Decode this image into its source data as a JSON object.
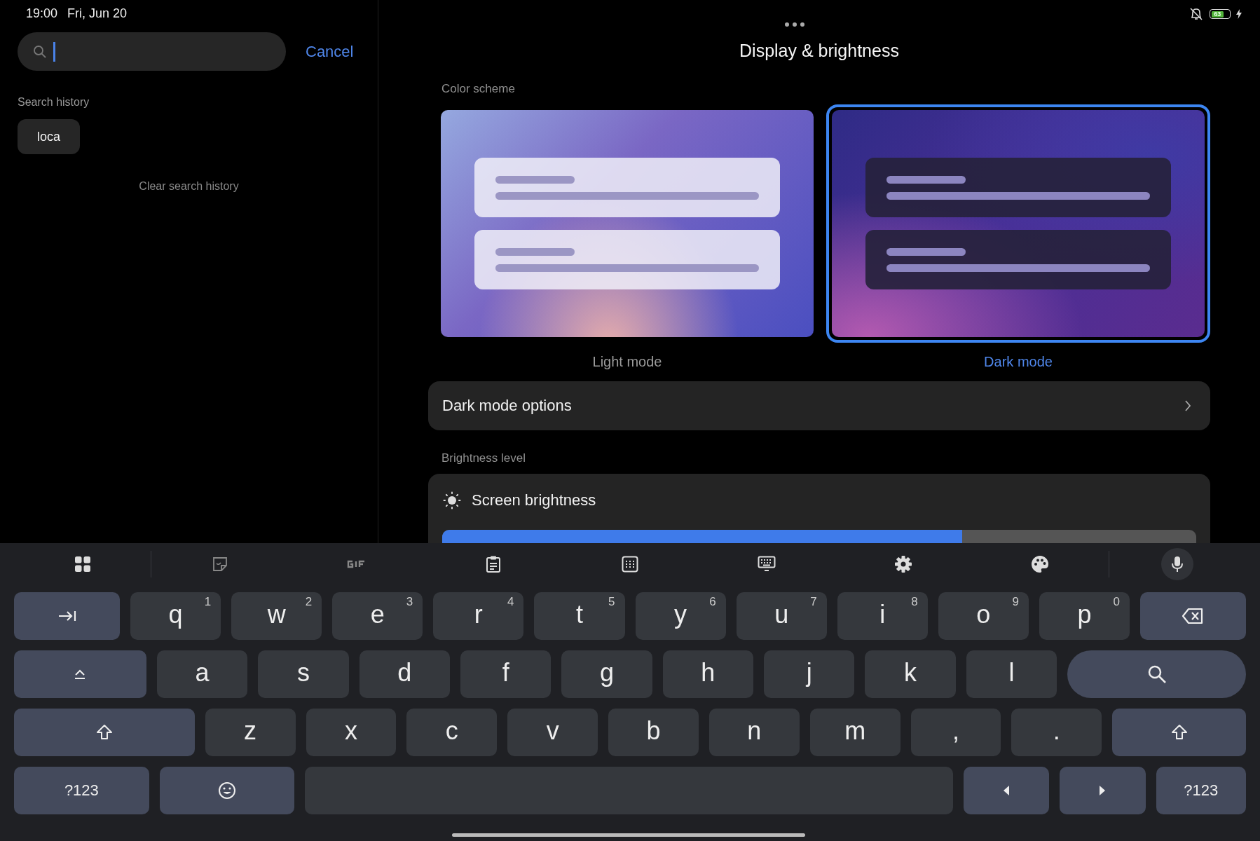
{
  "status_bar": {
    "time": "19:00",
    "date": "Fri, Jun 20",
    "battery": "63"
  },
  "search": {
    "cancel": "Cancel",
    "history_label": "Search history",
    "history": [
      "loca"
    ],
    "clear": "Clear search history"
  },
  "settings": {
    "title": "Display & brightness",
    "color_scheme_label": "Color scheme",
    "schemes": [
      {
        "kind": "light",
        "label": "Light mode",
        "selected": false
      },
      {
        "kind": "dark",
        "label": "Dark mode",
        "selected": true
      }
    ],
    "dark_mode_options": "Dark mode options",
    "brightness_label": "Brightness level",
    "brightness": {
      "label": "Screen brightness",
      "level": 0.69
    }
  },
  "keyboard": {
    "toolbar": [
      {
        "kind": "apps"
      },
      {
        "kind": "sticker"
      },
      {
        "kind": "gif"
      },
      {
        "kind": "clipboard"
      },
      {
        "kind": "numpad"
      },
      {
        "kind": "keyboard"
      },
      {
        "kind": "settings"
      },
      {
        "kind": "palette"
      },
      {
        "kind": "mic"
      }
    ],
    "rows": [
      [
        {
          "kind": "tab"
        },
        {
          "kind": "letter",
          "label": "q",
          "hint": "1"
        },
        {
          "kind": "letter",
          "label": "w",
          "hint": "2"
        },
        {
          "kind": "letter",
          "label": "e",
          "hint": "3"
        },
        {
          "kind": "letter",
          "label": "r",
          "hint": "4"
        },
        {
          "kind": "letter",
          "label": "t",
          "hint": "5"
        },
        {
          "kind": "letter",
          "label": "y",
          "hint": "6"
        },
        {
          "kind": "letter",
          "label": "u",
          "hint": "7"
        },
        {
          "kind": "letter",
          "label": "i",
          "hint": "8"
        },
        {
          "kind": "letter",
          "label": "o",
          "hint": "9"
        },
        {
          "kind": "letter",
          "label": "p",
          "hint": "0"
        },
        {
          "kind": "backspace"
        }
      ],
      [
        {
          "kind": "capslock"
        },
        {
          "kind": "letter",
          "label": "a"
        },
        {
          "kind": "letter",
          "label": "s"
        },
        {
          "kind": "letter",
          "label": "d"
        },
        {
          "kind": "letter",
          "label": "f"
        },
        {
          "kind": "letter",
          "label": "g"
        },
        {
          "kind": "letter",
          "label": "h"
        },
        {
          "kind": "letter",
          "label": "j"
        },
        {
          "kind": "letter",
          "label": "k"
        },
        {
          "kind": "letter",
          "label": "l"
        },
        {
          "kind": "search"
        }
      ],
      [
        {
          "kind": "shift"
        },
        {
          "kind": "letter",
          "label": "z"
        },
        {
          "kind": "letter",
          "label": "x"
        },
        {
          "kind": "letter",
          "label": "c"
        },
        {
          "kind": "letter",
          "label": "v"
        },
        {
          "kind": "letter",
          "label": "b"
        },
        {
          "kind": "letter",
          "label": "n"
        },
        {
          "kind": "letter",
          "label": "m"
        },
        {
          "kind": "letter",
          "label": ","
        },
        {
          "kind": "letter",
          "label": "."
        },
        {
          "kind": "shift"
        }
      ],
      [
        {
          "kind": "symbols",
          "label": "?123"
        },
        {
          "kind": "emoji"
        },
        {
          "kind": "space"
        },
        {
          "kind": "left"
        },
        {
          "kind": "right"
        },
        {
          "kind": "symbols",
          "label": "?123"
        }
      ]
    ]
  }
}
